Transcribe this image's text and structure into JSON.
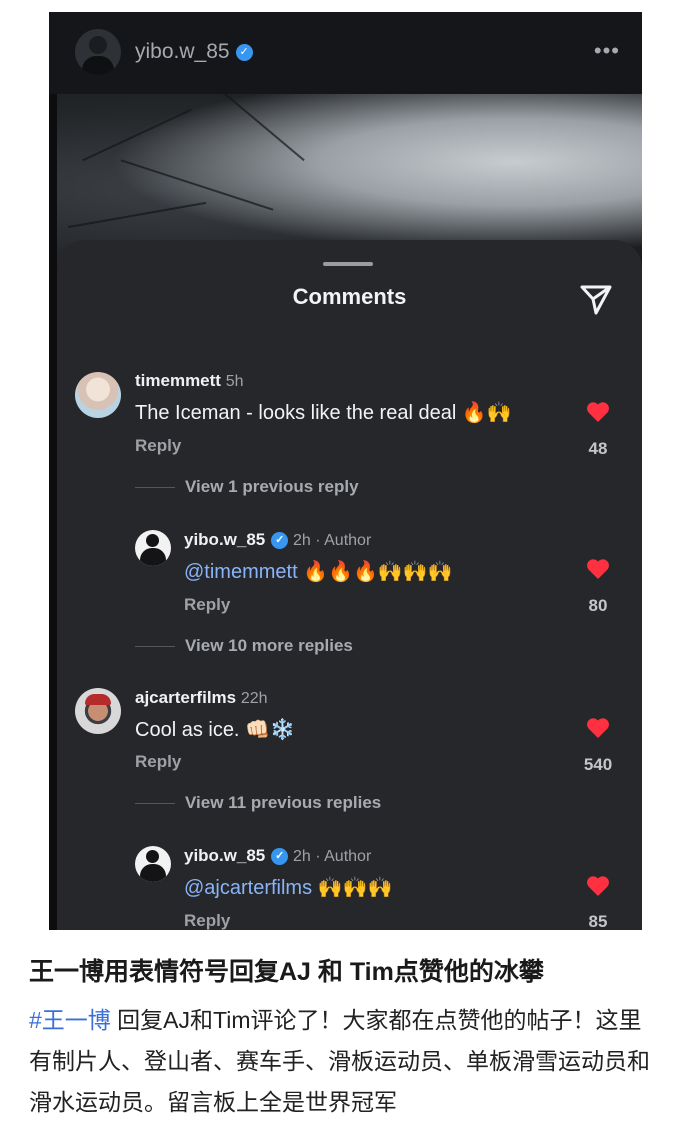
{
  "post": {
    "username": "yibo.w_85",
    "more_label": "•••"
  },
  "comments_sheet": {
    "title": "Comments",
    "items": [
      {
        "username": "timemmett",
        "time": "5h",
        "text": "The Iceman - looks like the real deal 🔥🙌",
        "reply_label": "Reply",
        "likes": "48"
      },
      {
        "username": "yibo.w_85",
        "time": "2h · Author",
        "mention": "@timemmett",
        "text": "🔥🔥🔥🙌🙌🙌",
        "reply_label": "Reply",
        "likes": "80"
      },
      {
        "username": "ajcarterfilms",
        "time": "22h",
        "text": "Cool as ice. 👊🏻❄️",
        "reply_label": "Reply",
        "likes": "540"
      },
      {
        "username": "yibo.w_85",
        "time": "2h · Author",
        "mention": "@ajcarterfilms",
        "text": "🙌🙌🙌",
        "reply_label": "Reply",
        "likes": "85"
      }
    ],
    "view_links": [
      "View 1 previous reply",
      "View 10 more replies",
      "View 11 previous replies"
    ]
  },
  "caption": {
    "title": "王一博用表情符号回复AJ 和 Tim点赞他的冰攀",
    "hashtag": "#王一博",
    "body": " 回复AJ和Tim评论了！大家都在点赞他的帖子！这里有制片人、登山者、赛车手、滑板运动员、单板滑雪运动员和滑水运动员。留言板上全是世界冠军"
  },
  "colors": {
    "sheet_bg": "#26272b",
    "like_red": "#ff3040",
    "verified_blue": "#3797f0",
    "mention_blue": "#8ab4f8",
    "hashtag_blue": "#3a6fd8"
  }
}
